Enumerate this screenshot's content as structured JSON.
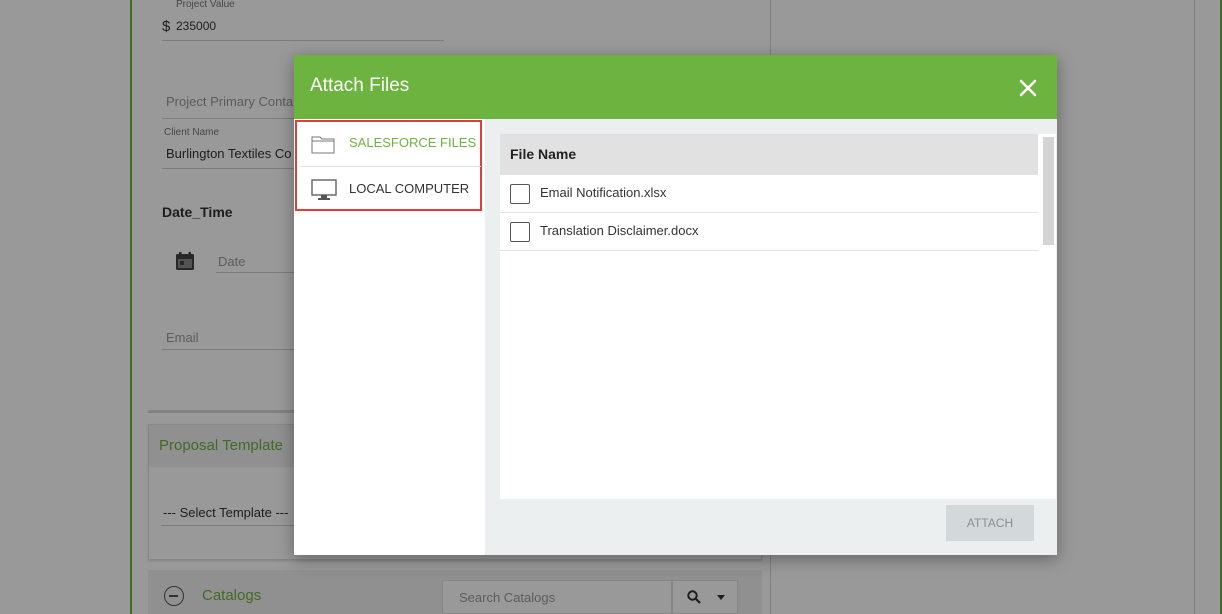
{
  "background_form": {
    "project_value_label": "Project Value",
    "currency_symbol": "$",
    "project_value": "235000",
    "primary_contact_placeholder": "Project Primary Conta",
    "client_name_label": "Client Name",
    "client_name_value": "Burlington Textiles Co",
    "date_time_heading": "Date_Time",
    "date_placeholder": "Date",
    "email_placeholder": "Email"
  },
  "proposal_template": {
    "title": "Proposal Template",
    "select_value": "--- Select Template ---"
  },
  "catalogs": {
    "title": "Catalogs",
    "search_placeholder": "Search Catalogs"
  },
  "modal": {
    "title": "Attach Files",
    "close_icon": "close-icon",
    "sources": [
      {
        "label": "SALESFORCE FILES",
        "icon": "folder-icon",
        "active": true
      },
      {
        "label": "LOCAL COMPUTER",
        "icon": "monitor-icon",
        "active": false
      }
    ],
    "table": {
      "column_header": "File Name",
      "files": [
        {
          "name": "Email Notification.xlsx",
          "checked": false
        },
        {
          "name": "Translation Disclaimer.docx",
          "checked": false
        }
      ]
    },
    "attach_label": "ATTACH"
  },
  "colors": {
    "brand_green": "#6cb33f",
    "highlight_red": "#e23b3b",
    "files_area_bg": "#ebeff0",
    "disabled_button_bg": "#d3d9da"
  }
}
